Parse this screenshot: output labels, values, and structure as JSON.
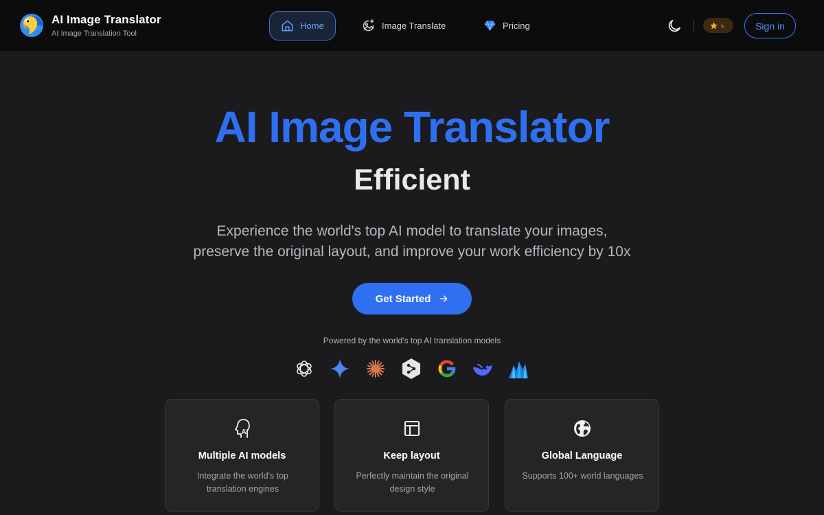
{
  "header": {
    "brand_title": "AI Image Translator",
    "brand_subtitle": "AI Image Translation Tool",
    "nav": [
      {
        "label": "Home",
        "icon": "home-icon",
        "active": true
      },
      {
        "label": "Image Translate",
        "icon": "image-sparkle-icon",
        "active": false
      },
      {
        "label": "Pricing",
        "icon": "diamond-icon",
        "active": false
      }
    ],
    "sign_in_label": "Sign in"
  },
  "hero": {
    "title": "AI Image Translator",
    "subtitle": "Efficient",
    "description_line1": "Experience the world's top AI model to translate your images,",
    "description_line2": "preserve the original layout, and improve your work efficiency by 10x",
    "cta_label": "Get Started",
    "powered_by": "Powered by the world's top AI translation models"
  },
  "models": [
    "openai-icon",
    "gemini-icon",
    "claude-icon",
    "deepl-icon",
    "google-icon",
    "deepseek-icon",
    "mistral-icon"
  ],
  "features": [
    {
      "icon": "ai-head-icon",
      "title": "Multiple AI models",
      "desc": "Integrate the world's top translation engines"
    },
    {
      "icon": "layout-icon",
      "title": "Keep layout",
      "desc": "Perfectly maintain the original design style"
    },
    {
      "icon": "globe-icon",
      "title": "Global Language",
      "desc": "Supports 100+ world languages"
    }
  ],
  "colors": {
    "accent": "#2f6ff2",
    "nav_bg": "#0c0c0d",
    "page_bg": "#1b1b1d",
    "card_bg": "#252527"
  }
}
